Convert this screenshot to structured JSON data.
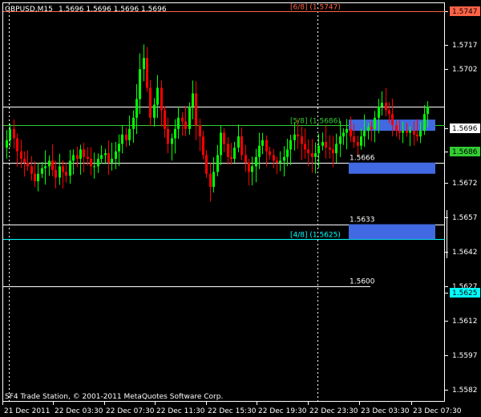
{
  "header": {
    "symbol": "GBPUSD,M15",
    "ohlc": "1.5696 1.5696 1.5696 1.5696"
  },
  "footer": {
    "copyright": "SF4 Trade Station, © 2001-2011 MetaQuotes Software Corp."
  },
  "colors": {
    "background": "#000000",
    "axis": "#ffffff",
    "bull": "#00ff00",
    "bear": "#ff0000",
    "level_red": "#ff6347",
    "level_green": "#32cd32",
    "level_cyan": "#00ffff",
    "zone_blue": "#4169e1",
    "hline": "#ffffff"
  },
  "price_axis": {
    "ticks": [
      "1.5747",
      "1.5717",
      "1.5702",
      "1.5696",
      "1.5686",
      "1.5672",
      "1.5657",
      "1.5642",
      "1.5627",
      "1.5625",
      "1.5612",
      "1.5597",
      "1.5582"
    ],
    "current_price": "1.5696",
    "marker_red": "1.5747",
    "marker_green": "1.5686",
    "marker_cyan": "1.5625"
  },
  "time_axis": {
    "labels": [
      "21 Dec 2011",
      "22 Dec 03:30",
      "22 Dec 07:30",
      "22 Dec 11:30",
      "22 Dec 15:30",
      "22 Dec 19:30",
      "22 Dec 23:30",
      "23 Dec 03:30",
      "23 Dec 07:30"
    ]
  },
  "murrey_levels": [
    {
      "label": "[6/8]",
      "value": "(1.5747)",
      "price": 1.5747,
      "color": "#ff6347"
    },
    {
      "label": "[5/8]",
      "value": "(1.5686)",
      "price": 1.5686,
      "color": "#32cd32"
    },
    {
      "label": "[4/8]",
      "value": "(1.5625)",
      "price": 1.5625,
      "color": "#00ffff"
    }
  ],
  "sr_levels": [
    {
      "label": "1.5666",
      "price": 1.5666
    },
    {
      "label": "1.5633",
      "price": 1.5633
    },
    {
      "label": "1.5600",
      "price": 1.56
    }
  ],
  "chart_data": {
    "type": "candlestick",
    "ylim": [
      1.5575,
      1.5755
    ],
    "x_dates": [
      "21 Dec 2011",
      "22 Dec 03:30",
      "22 Dec 07:30",
      "22 Dec 11:30",
      "22 Dec 15:30",
      "22 Dec 19:30",
      "22 Dec 23:30",
      "23 Dec 03:30",
      "23 Dec 07:30"
    ],
    "zones": [
      {
        "from": 1.5683,
        "to": 1.5689
      },
      {
        "from": 1.566,
        "to": 1.5666
      },
      {
        "from": 1.5625,
        "to": 1.5633
      }
    ],
    "close_path": [
      1.5678,
      1.5684,
      1.5679,
      1.5672,
      1.5668,
      1.5666,
      1.5664,
      1.566,
      1.5656,
      1.566,
      1.5663,
      1.5664,
      1.5667,
      1.5662,
      1.5658,
      1.5664,
      1.5661,
      1.5659,
      1.5667,
      1.567,
      1.5668,
      1.5673,
      1.5669,
      1.5668,
      1.5664,
      1.5664,
      1.5668,
      1.567,
      1.5671,
      1.5666,
      1.5668,
      1.5672,
      1.5676,
      1.5681,
      1.5678,
      1.5684,
      1.569,
      1.57,
      1.5716,
      1.5722,
      1.5706,
      1.569,
      1.5697,
      1.5706,
      1.5694,
      1.5684,
      1.5676,
      1.5679,
      1.5684,
      1.569,
      1.5688,
      1.5684,
      1.5696,
      1.5703,
      1.5686,
      1.568,
      1.567,
      1.566,
      1.5653,
      1.5661,
      1.567,
      1.5682,
      1.5676,
      1.5669,
      1.5668,
      1.5674,
      1.568,
      1.567,
      1.5666,
      1.5661,
      1.5664,
      1.5669,
      1.5675,
      1.5678,
      1.5672,
      1.567,
      1.5667,
      1.5666,
      1.5667,
      1.5669,
      1.5673,
      1.5678,
      1.5681,
      1.568,
      1.5676,
      1.5673,
      1.5671,
      1.5669,
      1.5671,
      1.5675,
      1.5677,
      1.5674,
      1.5673,
      1.5671,
      1.5676,
      1.568,
      1.5682,
      1.5684,
      1.568,
      1.5677,
      1.5675,
      1.568,
      1.5683,
      1.5685,
      1.5684,
      1.569,
      1.5696,
      1.5698,
      1.5694,
      1.5692,
      1.5686,
      1.5683,
      1.5682,
      1.5683,
      1.5682,
      1.5683,
      1.5681,
      1.568,
      1.5683,
      1.5692,
      1.5696
    ]
  }
}
